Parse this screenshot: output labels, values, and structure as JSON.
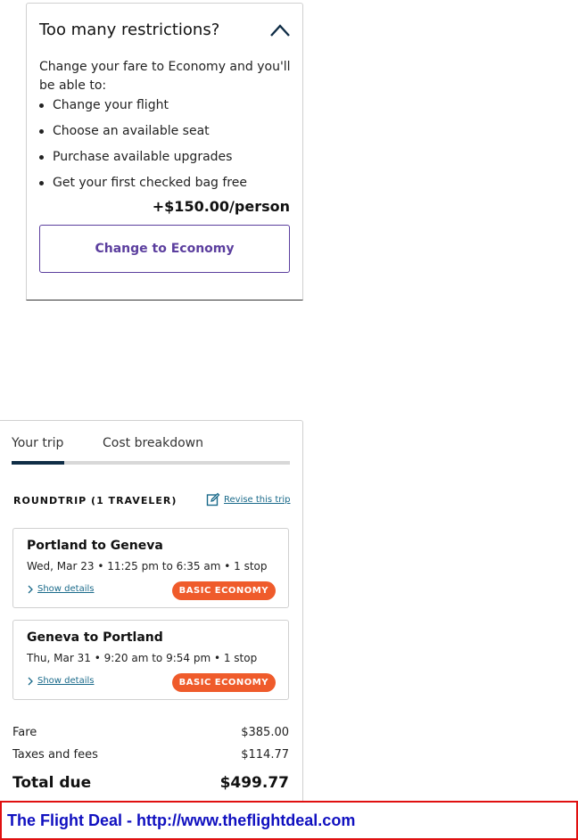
{
  "restrictions": {
    "title": "Too many restrictions?",
    "intro": "Change your fare to Economy and you'll be able to:",
    "benefits": [
      "Change your flight",
      "Choose an available seat",
      "Purchase available upgrades",
      "Get your first checked bag free"
    ],
    "price": "+$150.00/person",
    "button_label": "Change to Economy"
  },
  "trip": {
    "tabs": [
      "Your trip",
      "Cost breakdown"
    ],
    "active_tab": "Your trip",
    "heading": "ROUNDTRIP (1 TRAVELER)",
    "revise_label": "Revise this trip",
    "flights": [
      {
        "route": "Portland to Geneva",
        "details": "Wed, Mar 23 • 11:25 pm to 6:35 am • 1 stop",
        "show_details": "Show details",
        "fare_class": "BASIC ECONOMY"
      },
      {
        "route": "Geneva to Portland",
        "details": "Thu, Mar 31 • 9:20 am to 9:54 pm • 1 stop",
        "show_details": "Show details",
        "fare_class": "BASIC ECONOMY"
      }
    ],
    "costs": {
      "fare_label": "Fare",
      "fare_value": "$385.00",
      "taxes_label": "Taxes and fees",
      "taxes_value": "$114.77",
      "total_label": "Total due",
      "total_value": "$499.77"
    }
  },
  "footer": {
    "text": "The Flight Deal - http://www.theflightdeal.com"
  },
  "colors": {
    "accent_purple": "#5b3e9e",
    "badge_orange": "#ef5b2b",
    "tab_active": "#0f2d46",
    "link": "#1a6a8a",
    "footer_border": "#e01010",
    "footer_text": "#1010c0"
  },
  "icons": [
    "chevron-up-icon",
    "edit-icon",
    "chevron-right-icon"
  ]
}
